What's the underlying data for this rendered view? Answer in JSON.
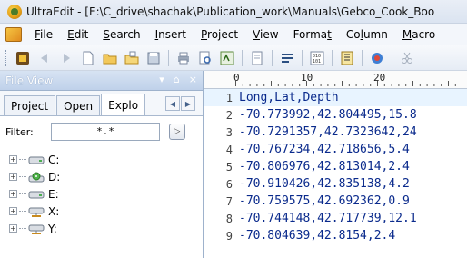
{
  "window": {
    "title": "UltraEdit - [E:\\C_drive\\shachak\\Publication_work\\Manuals\\Gebco_Cook_Boo"
  },
  "menu": [
    {
      "label": "File",
      "underline": "F",
      "rest": "ile"
    },
    {
      "label": "Edit",
      "underline": "E",
      "rest": "dit"
    },
    {
      "label": "Search",
      "underline": "S",
      "rest": "earch"
    },
    {
      "label": "Insert",
      "underline": "I",
      "rest": "nsert"
    },
    {
      "label": "Project",
      "underline": "P",
      "rest": "roject"
    },
    {
      "label": "View",
      "underline": "V",
      "rest": "iew"
    },
    {
      "label": "Format",
      "pre": "Forma",
      "underline": "t",
      "rest": ""
    },
    {
      "label": "Column",
      "pre": "Co",
      "underline": "l",
      "rest": "umn"
    },
    {
      "label": "Macro",
      "underline": "M",
      "rest": "acro"
    }
  ],
  "toolbar": {
    "icons": [
      "app-settings-icon",
      "back-arrow-icon",
      "forward-arrow-icon",
      "new-file-icon",
      "open-folder-icon",
      "open-file-icon",
      "save-icon",
      "print-icon",
      "print-preview-icon",
      "find-icon",
      "document-icon",
      "wordwrap-icon",
      "hex-icon",
      "column-mode-icon",
      "browser-icon",
      "cut-icon"
    ]
  },
  "file_view": {
    "header": "File View",
    "pin_glyph": "▾",
    "dock_glyph": "⌂",
    "close_glyph": "×",
    "tabs": [
      "Project",
      "Open",
      "Explo"
    ],
    "active_tab": 2,
    "filter_label": "Filter:",
    "filter_value": "*.*",
    "drives": [
      {
        "label": "C:",
        "type": "hard-drive"
      },
      {
        "label": "D:",
        "type": "optical-drive"
      },
      {
        "label": "E:",
        "type": "hard-drive"
      },
      {
        "label": "X:",
        "type": "network-drive"
      },
      {
        "label": "Y:",
        "type": "network-drive"
      }
    ]
  },
  "editor": {
    "ruler": {
      "marks": [
        "0",
        "10",
        "20"
      ]
    },
    "lines": [
      {
        "num": "1",
        "text": "Long,Lat,Depth"
      },
      {
        "num": "2",
        "text": "-70.773992,42.804495,15.8"
      },
      {
        "num": "3",
        "text": "-70.7291357,42.7323642,24"
      },
      {
        "num": "4",
        "text": "-70.767234,42.718656,5.4"
      },
      {
        "num": "5",
        "text": "-70.806976,42.813014,2.4"
      },
      {
        "num": "6",
        "text": "-70.910426,42.835138,4.2"
      },
      {
        "num": "7",
        "text": "-70.759575,42.692362,0.9"
      },
      {
        "num": "8",
        "text": "-70.744148,42.717739,12.1"
      },
      {
        "num": "9",
        "text": "-70.804639,42.8154,2.4"
      }
    ],
    "active_line": 0
  },
  "colors": {
    "code_text": "#0a2a8c",
    "active_line_bg": "#e8f4ff",
    "panel_header": "#c5d6ee"
  }
}
